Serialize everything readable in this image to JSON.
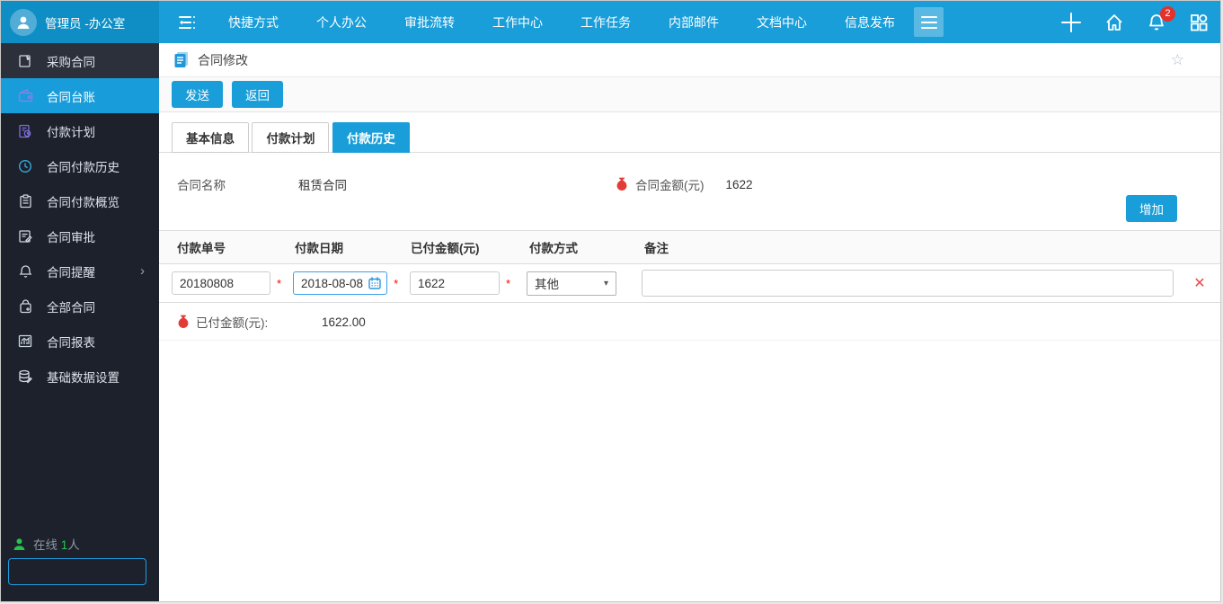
{
  "topbar": {
    "user_name": "管理员 -办公室",
    "nav": [
      "快捷方式",
      "个人办公",
      "审批流转",
      "工作中心",
      "工作任务",
      "内部邮件",
      "文档中心",
      "信息发布"
    ],
    "notification_count": "2"
  },
  "sidebar": {
    "items": [
      {
        "label": "采购合同",
        "icon": "contract-doc-icon"
      },
      {
        "label": "合同台账",
        "icon": "wallet-icon",
        "active": true
      },
      {
        "label": "付款计划",
        "icon": "payment-plan-icon"
      },
      {
        "label": "合同付款历史",
        "icon": "clock-icon"
      },
      {
        "label": "合同付款概览",
        "icon": "clipboard-icon"
      },
      {
        "label": "合同审批",
        "icon": "approval-doc-icon"
      },
      {
        "label": "合同提醒",
        "icon": "bell-icon",
        "has_submenu": true
      },
      {
        "label": "全部合同",
        "icon": "bag-icon"
      },
      {
        "label": "合同报表",
        "icon": "chart-icon"
      },
      {
        "label": "基础数据设置",
        "icon": "database-icon"
      }
    ],
    "submenu_arrow": "›",
    "online": {
      "prefix": "在线",
      "count": "1",
      "suffix": "人"
    }
  },
  "content": {
    "page_title": "合同修改",
    "favorite_icon": "☆",
    "toolbar": {
      "send": "发送",
      "back": "返回"
    },
    "tabs": [
      "基本信息",
      "付款计划",
      "付款历史"
    ],
    "active_tab": "付款历史",
    "form": {
      "name_label": "合同名称",
      "name_value": "租赁合同",
      "amount_label": "合同金额(元)",
      "amount_value": "1622",
      "add_button": "增加"
    },
    "table": {
      "headers": [
        "付款单号",
        "付款日期",
        "已付金额(元)",
        "付款方式",
        "备注"
      ],
      "required_marker": "*",
      "caret_icon": "▾",
      "delete_icon": "✕",
      "row": {
        "payment_no": "20180808",
        "payment_date": "2018-08-08",
        "paid_amount": "1622",
        "payment_method": "其他",
        "remark": ""
      }
    },
    "summary": {
      "label": "已付金额(元):",
      "value": "1622.00"
    }
  },
  "colors": {
    "topbar_blue": "#199ed9",
    "user_area_blue": "#0e8ec5",
    "sidebar_bg": "#1c212b",
    "sidebar_active_blue": "#189cda",
    "button_blue": "#199ed9",
    "accent_red": "#e8413c",
    "online_green": "#27c24c",
    "search_border_blue": "#1e9ce0"
  }
}
